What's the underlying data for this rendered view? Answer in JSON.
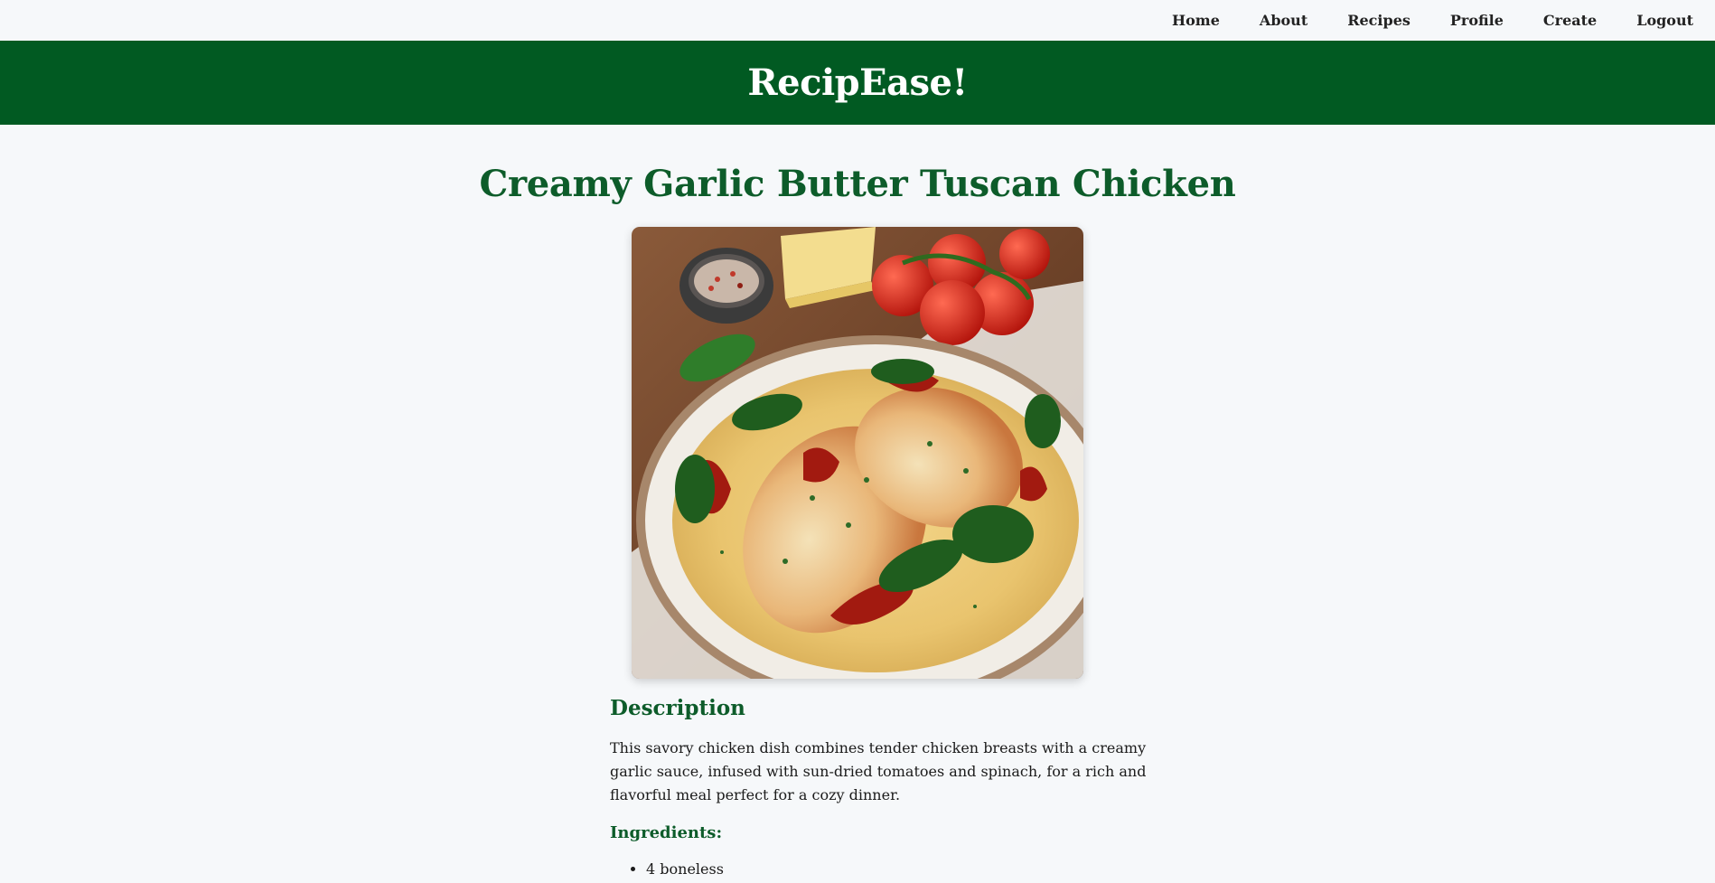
{
  "nav": {
    "items": [
      {
        "label": "Home"
      },
      {
        "label": "About"
      },
      {
        "label": "Recipes"
      },
      {
        "label": "Profile"
      },
      {
        "label": "Create"
      },
      {
        "label": "Logout"
      }
    ]
  },
  "header": {
    "site_title": "RecipEase!"
  },
  "recipe": {
    "title": "Creamy Garlic Butter Tuscan Chicken",
    "description_heading": "Description",
    "description": "This savory chicken dish combines tender chicken breasts with a creamy garlic sauce, infused with sun-dried tomatoes and spinach, for a rich and flavorful meal perfect for a cozy dinner.",
    "ingredients_heading": "Ingredients:",
    "ingredients": [
      "4 boneless"
    ]
  },
  "colors": {
    "brand_green": "#015a22",
    "heading_green": "#0d5c2a",
    "page_bg": "#f6f8fa"
  }
}
